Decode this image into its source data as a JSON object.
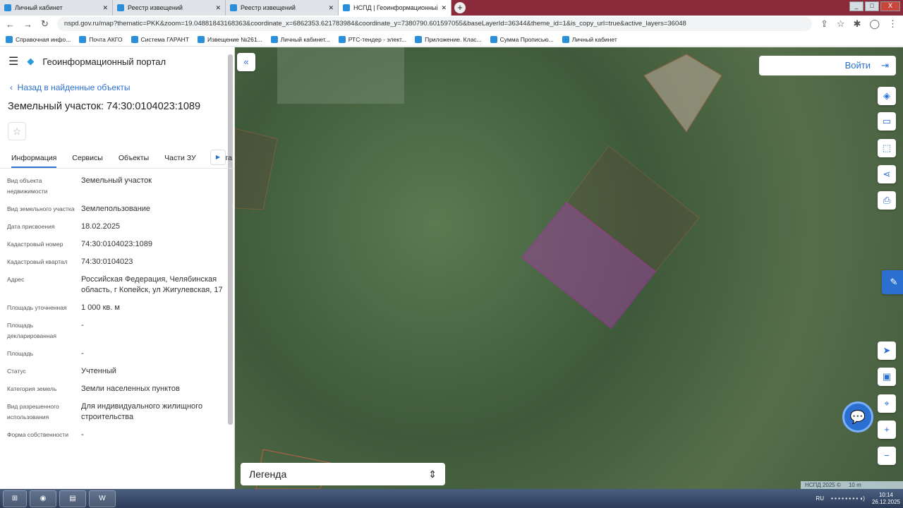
{
  "browser": {
    "tabs": [
      {
        "title": "Личный кабинет"
      },
      {
        "title": "Реестр извещений"
      },
      {
        "title": "Реестр извещений"
      },
      {
        "title": "НСПД | Геоинформационный п"
      }
    ],
    "url": "nspd.gov.ru/map?thematic=PKK&zoom=19.04881843168363&coordinate_x=6862353.621783984&coordinate_y=7380790.601597055&baseLayerId=36344&theme_id=1&is_copy_url=true&active_layers=36048",
    "bookmarks": [
      "Справочная инфо...",
      "Почта АКГО",
      "Система ГАРАНТ",
      "Извещение №261...",
      "Личный кабинет...",
      "РТС-тендер - элект...",
      "Приложение. Клас...",
      "Сумма Прописью...",
      "Личный кабинет"
    ]
  },
  "sidebar": {
    "portal_title": "Геоинформационный портал",
    "back_link": "Назад в найденные объекты",
    "object_title": "Земельный участок: 74:30:0104023:1089",
    "tabs": [
      "Информация",
      "Сервисы",
      "Объекты",
      "Части ЗУ",
      "Соста"
    ],
    "rows": [
      {
        "k": "Вид объекта недвижимости",
        "v": "Земельный участок"
      },
      {
        "k": "Вид земельного участка",
        "v": "Землепользование"
      },
      {
        "k": "Дата присвоения",
        "v": "18.02.2025"
      },
      {
        "k": "Кадастровый номер",
        "v": "74:30:0104023:1089"
      },
      {
        "k": "Кадастровый квартал",
        "v": "74:30:0104023"
      },
      {
        "k": "Адрес",
        "v": "Российская Федерация, Челябинская область, г Копейск, ул Жигулевская, 17"
      },
      {
        "k": "Площадь уточненная",
        "v": "1 000 кв. м"
      },
      {
        "k": "Площадь декларированная",
        "v": "-"
      },
      {
        "k": "Площадь",
        "v": "-"
      },
      {
        "k": "Статус",
        "v": "Учтенный"
      },
      {
        "k": "Категория земель",
        "v": "Земли населенных пунктов"
      },
      {
        "k": "Вид разрешенного использования",
        "v": "Для индивидуального жилищного строительства"
      },
      {
        "k": "Форма собственности",
        "v": "-"
      }
    ]
  },
  "map": {
    "login": "Войти",
    "legend": "Легенда",
    "copyright": "НСПД 2025 ©",
    "scale": "10 m",
    "accent": "#2b6fd1"
  },
  "taskbar": {
    "lang": "RU",
    "time": "10:14",
    "date": "26.12.2025"
  }
}
